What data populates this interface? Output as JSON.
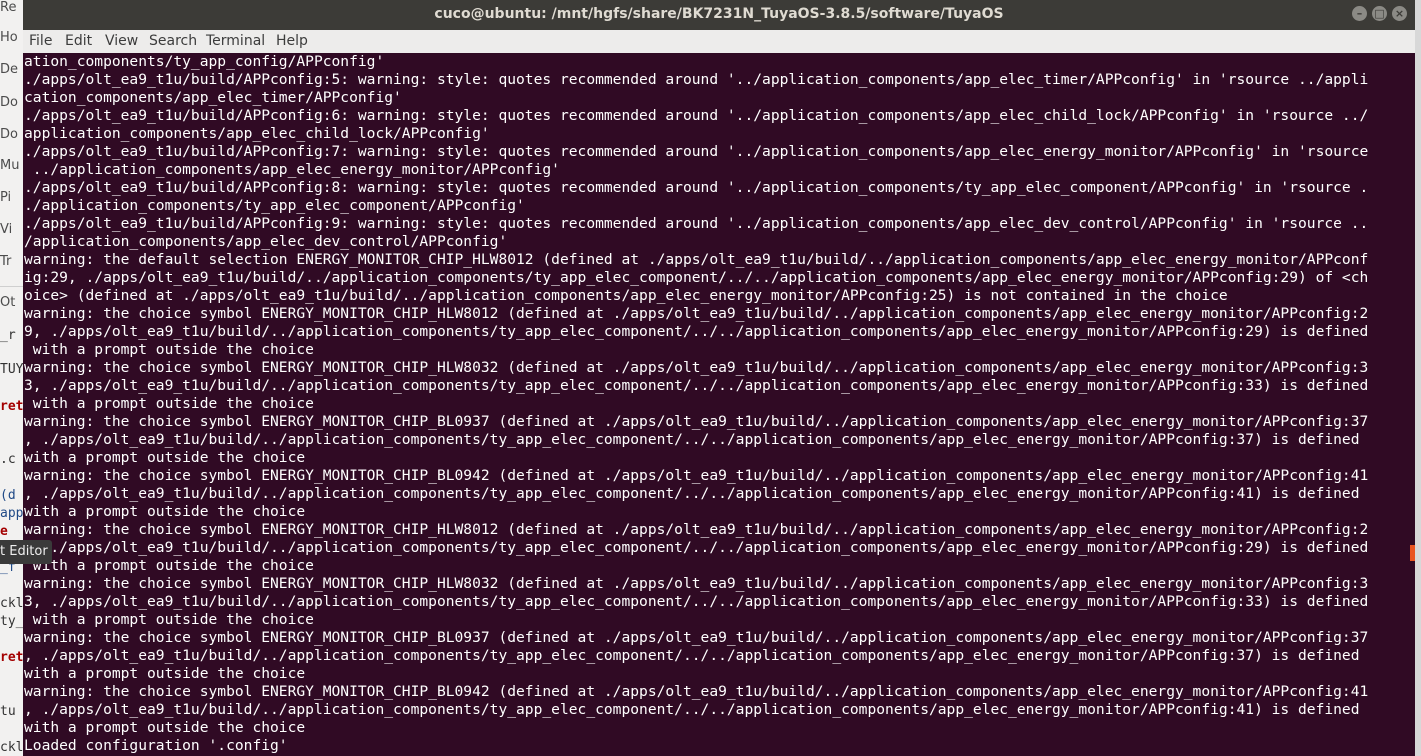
{
  "background_app": {
    "tabs": [
      "Re",
      "Ho",
      "De",
      "Do",
      "Do",
      "Mu",
      "Pi",
      "Vi",
      "Tr",
      "Ot"
    ],
    "code_fragments": [
      "_r",
      "TUY",
      "ret",
      ".c",
      "(d",
      "app",
      "e",
      "_f",
      "ckl",
      "ty_",
      "ret",
      "tu",
      "ckl"
    ],
    "tooltip": "t Editor"
  },
  "terminal": {
    "title": "cuco@ubuntu: /mnt/hgfs/share/BK7231N_TuyaOS-3.8.5/software/TuyaOS",
    "window_buttons": {
      "minimize": "–",
      "maximize": "□",
      "close": "×"
    },
    "menu": [
      "File",
      "Edit",
      "View",
      "Search",
      "Terminal",
      "Help"
    ],
    "lines": [
      "ation_components/ty_app_config/APPconfig'",
      "./apps/olt_ea9_t1u/build/APPconfig:5: warning: style: quotes recommended around '../application_components/app_elec_timer/APPconfig' in 'rsource ../appli",
      "cation_components/app_elec_timer/APPconfig'",
      "./apps/olt_ea9_t1u/build/APPconfig:6: warning: style: quotes recommended around '../application_components/app_elec_child_lock/APPconfig' in 'rsource ../",
      "application_components/app_elec_child_lock/APPconfig'",
      "./apps/olt_ea9_t1u/build/APPconfig:7: warning: style: quotes recommended around '../application_components/app_elec_energy_monitor/APPconfig' in 'rsource",
      " ../application_components/app_elec_energy_monitor/APPconfig'",
      "./apps/olt_ea9_t1u/build/APPconfig:8: warning: style: quotes recommended around '../application_components/ty_app_elec_component/APPconfig' in 'rsource .",
      "./application_components/ty_app_elec_component/APPconfig'",
      "./apps/olt_ea9_t1u/build/APPconfig:9: warning: style: quotes recommended around '../application_components/app_elec_dev_control/APPconfig' in 'rsource ..",
      "/application_components/app_elec_dev_control/APPconfig'",
      "warning: the default selection ENERGY_MONITOR_CHIP_HLW8012 (defined at ./apps/olt_ea9_t1u/build/../application_components/app_elec_energy_monitor/APPconf",
      "ig:29, ./apps/olt_ea9_t1u/build/../application_components/ty_app_elec_component/../../application_components/app_elec_energy_monitor/APPconfig:29) of <ch",
      "oice> (defined at ./apps/olt_ea9_t1u/build/../application_components/app_elec_energy_monitor/APPconfig:25) is not contained in the choice",
      "warning: the choice symbol ENERGY_MONITOR_CHIP_HLW8012 (defined at ./apps/olt_ea9_t1u/build/../application_components/app_elec_energy_monitor/APPconfig:2",
      "9, ./apps/olt_ea9_t1u/build/../application_components/ty_app_elec_component/../../application_components/app_elec_energy_monitor/APPconfig:29) is defined",
      " with a prompt outside the choice",
      "warning: the choice symbol ENERGY_MONITOR_CHIP_HLW8032 (defined at ./apps/olt_ea9_t1u/build/../application_components/app_elec_energy_monitor/APPconfig:3",
      "3, ./apps/olt_ea9_t1u/build/../application_components/ty_app_elec_component/../../application_components/app_elec_energy_monitor/APPconfig:33) is defined",
      " with a prompt outside the choice",
      "warning: the choice symbol ENERGY_MONITOR_CHIP_BL0937 (defined at ./apps/olt_ea9_t1u/build/../application_components/app_elec_energy_monitor/APPconfig:37",
      ", ./apps/olt_ea9_t1u/build/../application_components/ty_app_elec_component/../../application_components/app_elec_energy_monitor/APPconfig:37) is defined",
      "with a prompt outside the choice",
      "warning: the choice symbol ENERGY_MONITOR_CHIP_BL0942 (defined at ./apps/olt_ea9_t1u/build/../application_components/app_elec_energy_monitor/APPconfig:41",
      ", ./apps/olt_ea9_t1u/build/../application_components/ty_app_elec_component/../../application_components/app_elec_energy_monitor/APPconfig:41) is defined",
      "with a prompt outside the choice",
      "warning: the choice symbol ENERGY_MONITOR_CHIP_HLW8012 (defined at ./apps/olt_ea9_t1u/build/../application_components/app_elec_energy_monitor/APPconfig:2",
      "9, ./apps/olt_ea9_t1u/build/../application_components/ty_app_elec_component/../../application_components/app_elec_energy_monitor/APPconfig:29) is defined",
      " with a prompt outside the choice",
      "warning: the choice symbol ENERGY_MONITOR_CHIP_HLW8032 (defined at ./apps/olt_ea9_t1u/build/../application_components/app_elec_energy_monitor/APPconfig:3",
      "3, ./apps/olt_ea9_t1u/build/../application_components/ty_app_elec_component/../../application_components/app_elec_energy_monitor/APPconfig:33) is defined",
      " with a prompt outside the choice",
      "warning: the choice symbol ENERGY_MONITOR_CHIP_BL0937 (defined at ./apps/olt_ea9_t1u/build/../application_components/app_elec_energy_monitor/APPconfig:37",
      ", ./apps/olt_ea9_t1u/build/../application_components/ty_app_elec_component/../../application_components/app_elec_energy_monitor/APPconfig:37) is defined",
      "with a prompt outside the choice",
      "warning: the choice symbol ENERGY_MONITOR_CHIP_BL0942 (defined at ./apps/olt_ea9_t1u/build/../application_components/app_elec_energy_monitor/APPconfig:41",
      ", ./apps/olt_ea9_t1u/build/../application_components/ty_app_elec_component/../../application_components/app_elec_energy_monitor/APPconfig:41) is defined",
      "with a prompt outside the choice",
      "Loaded configuration '.config'"
    ],
    "colors": {
      "background": "#300a24",
      "text": "#ffffff",
      "titlebar": "#3c3b37",
      "accent": "#e95420"
    }
  }
}
